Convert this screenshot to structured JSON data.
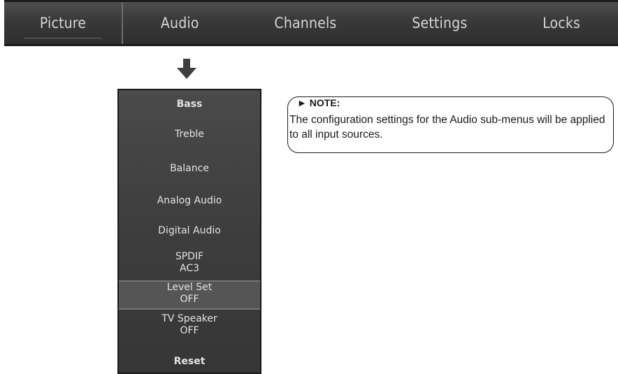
{
  "menu": {
    "tabs": [
      {
        "label": "Picture"
      },
      {
        "label": "Audio"
      },
      {
        "label": "Channels"
      },
      {
        "label": "Settings"
      },
      {
        "label": "Locks"
      }
    ]
  },
  "audio_menu": {
    "items": [
      {
        "label": "Bass"
      },
      {
        "label": "Treble"
      },
      {
        "label": "Balance"
      },
      {
        "label": "Analog Audio"
      },
      {
        "label": "Digital Audio"
      },
      {
        "label": "SPDIF",
        "value": "AC3"
      },
      {
        "label": "Level Set",
        "value": "OFF"
      },
      {
        "label": "TV Speaker",
        "value": "OFF"
      },
      {
        "label": "Reset"
      }
    ]
  },
  "note": {
    "marker": "►",
    "title": "NOTE:",
    "text": "The configuration settings for the Audio sub-menus will be applied to all input sources."
  },
  "colors": {
    "menubar": "#3a3a3a",
    "menu_text": "#d6d6d6",
    "submenu_bg": "#404040",
    "highlight": "#555555"
  },
  "icons": {
    "arrow": "down-arrow-icon"
  }
}
